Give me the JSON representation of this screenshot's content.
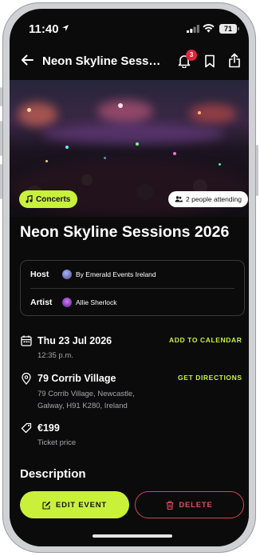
{
  "status_bar": {
    "time": "11:40",
    "battery": "71"
  },
  "topbar": {
    "title": "Neon Skyline Sessions 2026",
    "notification_count": "3"
  },
  "hero": {
    "category": "Concerts",
    "attendees": "2 people attending"
  },
  "event": {
    "title": "Neon Skyline Sessions 2026"
  },
  "people": {
    "host_label": "Host",
    "host_name": "By Emerald Events Ireland",
    "artist_label": "Artist",
    "artist_name": "Allie Sherlock"
  },
  "date": {
    "date": "Thu 23 Jul 2026",
    "time": "12:35 p.m.",
    "action": "ADD TO CALENDAR"
  },
  "location": {
    "name": "79 Corrib Village",
    "address_line1": "79 Corrib Village, Newcastle,",
    "address_line2": "Galway, H91 K280, Ireland",
    "action": "GET DIRECTIONS"
  },
  "price": {
    "amount": "€199",
    "label": "Ticket price"
  },
  "description": {
    "heading": "Description"
  },
  "actions": {
    "edit": "EDIT EVENT",
    "delete": "DELETE"
  },
  "colors": {
    "accent": "#c9f13a",
    "danger": "#d94450",
    "background": "#0b0b0c"
  },
  "icons": [
    "back-arrow-icon",
    "bell-icon",
    "bookmark-icon",
    "share-icon",
    "calendar-icon",
    "location-pin-icon",
    "tag-icon",
    "edit-icon",
    "trash-icon",
    "people-icon",
    "music-note-icon"
  ]
}
